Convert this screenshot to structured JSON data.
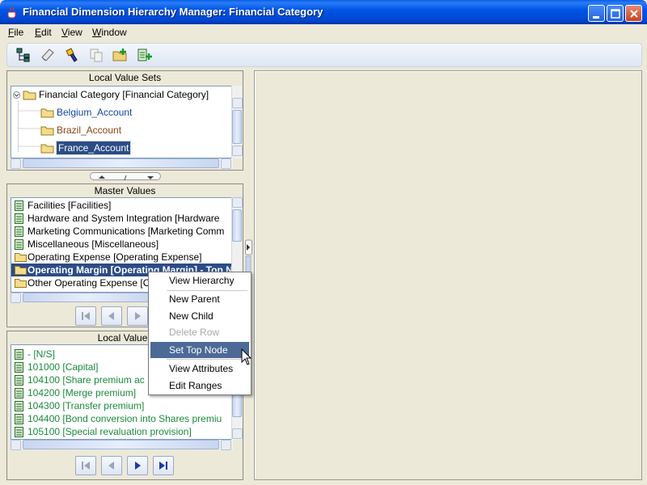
{
  "window": {
    "title": "Financial Dimension Hierarchy Manager: Financial Category"
  },
  "menu": {
    "items": [
      {
        "label": "File",
        "accel": "F"
      },
      {
        "label": "Edit",
        "accel": "E"
      },
      {
        "label": "View",
        "accel": "V"
      },
      {
        "label": "Window",
        "accel": "W"
      }
    ]
  },
  "toolbar": {
    "buttons": [
      {
        "name": "hierarchy-icon"
      },
      {
        "name": "edit-icon"
      },
      {
        "name": "flashlight-icon"
      },
      {
        "name": "copy-icon"
      },
      {
        "name": "new-folder-icon"
      },
      {
        "name": "new-item-icon"
      }
    ]
  },
  "local_value_sets": {
    "title": "Local Value Sets",
    "root": "Financial Category  [Financial Category]",
    "children": [
      "Belgium_Account",
      "Brazil_Account",
      "France_Account"
    ],
    "selected_index": 2
  },
  "master_values": {
    "title": "Master Values",
    "rows": [
      {
        "text": "Facilities  [Facilities]",
        "icon": "leaf"
      },
      {
        "text": "Hardware and System Integration  [Hardware",
        "icon": "leaf"
      },
      {
        "text": "Marketing Communications  [Marketing Comm",
        "icon": "leaf"
      },
      {
        "text": "Miscellaneous  [Miscellaneous]",
        "icon": "leaf"
      },
      {
        "text": "Operating Expense  [Operating Expense]",
        "icon": "folder"
      },
      {
        "text": "Operating Margin  [Operating Margin] - Top N",
        "icon": "folder",
        "selected": true
      },
      {
        "text": "Other Operating Expense  [O",
        "icon": "folder"
      }
    ]
  },
  "local_values": {
    "title": "Local Values",
    "rows": [
      {
        "text": "-  [N/S]"
      },
      {
        "text": "101000  [Capital]"
      },
      {
        "text": "104100  [Share premium ac"
      },
      {
        "text": "104200  [Merge premium]"
      },
      {
        "text": "104300  [Transfer premium]"
      },
      {
        "text": "104400  [Bond conversion into Shares premiu"
      },
      {
        "text": "105100  [Special revaluation provision]"
      }
    ]
  },
  "context_menu": {
    "items": [
      {
        "label": "View Hierarchy",
        "enabled": true
      },
      {
        "label": "New Parent",
        "enabled": true
      },
      {
        "label": "New Child",
        "enabled": true
      },
      {
        "label": "Delete Row",
        "enabled": false
      },
      {
        "label": "Set Top Node",
        "enabled": true,
        "highlighted": true
      },
      {
        "label": "View Attributes",
        "enabled": true
      },
      {
        "label": "Edit Ranges",
        "enabled": true
      }
    ]
  },
  "colors": {
    "selection": "#2b4c86",
    "menu_highlight": "#4d6a97",
    "local_value_text": "#1b8a3e",
    "value_set_blue": "#1346a5",
    "value_set_brown": "#8b4513"
  }
}
